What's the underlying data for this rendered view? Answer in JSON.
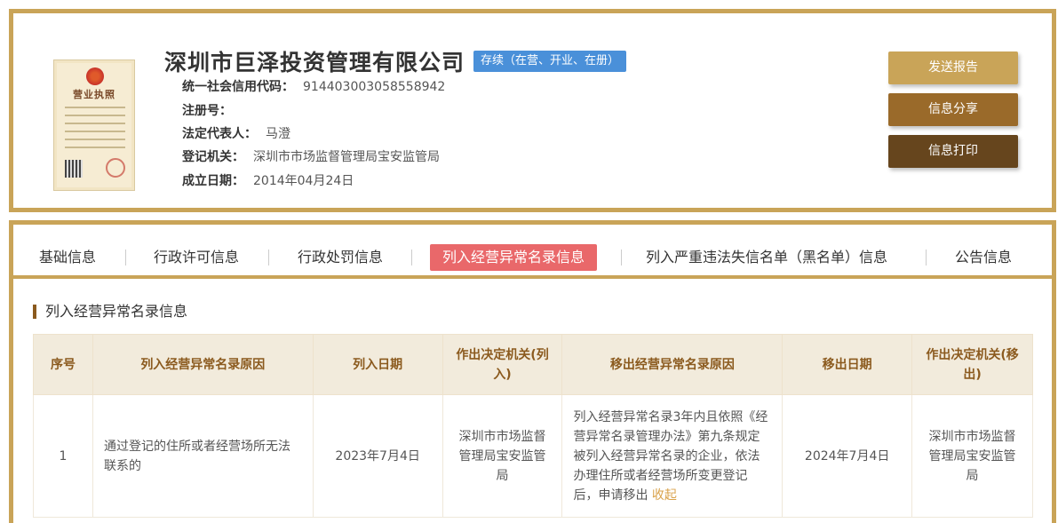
{
  "company": {
    "name": "深圳市巨泽投资管理有限公司",
    "status": "存续（在营、开业、在册）",
    "license_title": "营业执照",
    "fields": [
      {
        "label": "统一社会信用代码：",
        "value": "91440300305855894​2"
      },
      {
        "label": "注册号：",
        "value": ""
      },
      {
        "label": "法定代表人：",
        "value": "马澄"
      },
      {
        "label": "登记机关：",
        "value": "深圳市市场监督管理局宝安监管局"
      },
      {
        "label": "成立日期：",
        "value": "2014年04月24日"
      }
    ]
  },
  "actions": {
    "send": "发送报告",
    "share": "信息分享",
    "print": "信息打印"
  },
  "tabs": [
    {
      "label": "基础信息"
    },
    {
      "label": "行政许可信息"
    },
    {
      "label": "行政处罚信息"
    },
    {
      "label": "列入经营异常名录信息",
      "active": true
    },
    {
      "label": "列入严重违法失信名单（黑名单）信息"
    },
    {
      "label": "公告信息"
    }
  ],
  "section": {
    "title": "列入经营异常名录信息"
  },
  "table": {
    "headers": [
      "序号",
      "列入经营异常名录原因",
      "列入日期",
      "作出决定机关(列入)",
      "移出经营异常名录原因",
      "移出日期",
      "作出决定机关(移出)"
    ],
    "rows": [
      {
        "index": "1",
        "reason_in": "通过登记的住所或者经营场所无法联系的",
        "date_in": "2023年7月4日",
        "authority_in": "深圳市市场监督管理局宝安监管局",
        "reason_out": "列入经营异常名录3年内且依照《经营异常名录管理办法》第九条规定被列入经营异常名录的企业，依法办理住所或者经营场所变更登记后，申请移出",
        "fold_label": "收起",
        "date_out": "2024年7月4日",
        "authority_out": "深圳市市场监督管理局宝安监管局"
      }
    ]
  },
  "colors": {
    "gold": "#c9a458",
    "brown": "#9a6a2a",
    "dark_brown": "#66451d",
    "active_tab": "#e9686a",
    "status_blue": "#4a90d9"
  }
}
